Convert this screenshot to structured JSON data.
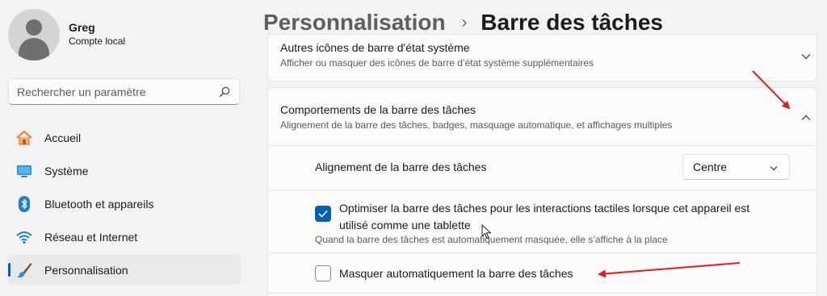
{
  "user": {
    "name": "Greg",
    "account_type": "Compte local"
  },
  "search": {
    "placeholder": "Rechercher un paramètre"
  },
  "sidebar": {
    "items": [
      {
        "label": "Accueil",
        "icon": "home-icon"
      },
      {
        "label": "Système",
        "icon": "system-display-icon"
      },
      {
        "label": "Bluetooth et appareils",
        "icon": "bluetooth-icon"
      },
      {
        "label": "Réseau et Internet",
        "icon": "wifi-icon"
      },
      {
        "label": "Personnalisation",
        "icon": "brush-icon",
        "active": true
      }
    ]
  },
  "breadcrumb": {
    "parent": "Personnalisation",
    "separator": "›",
    "current": "Barre des tâches"
  },
  "sections": {
    "system_tray_icons": {
      "title": "Autres icônes de barre d'état système",
      "subtitle": "Afficher ou masquer des icônes de barre d’état système supplémentaires",
      "expanded": false
    },
    "behaviors": {
      "title": "Comportements de la barre des tâches",
      "subtitle": "Alignement de la barre des tâches, badges, masquage automatique, et affichages multiples",
      "expanded": true,
      "alignment": {
        "label": "Alignement de la barre des tâches",
        "value": "Centre"
      },
      "touch_optimize": {
        "label": "Optimiser la barre des tâches pour les interactions tactiles lorsque cet appareil est utilisé comme une tablette",
        "help": "Quand la barre des tâches est automatiquement masquée, elle s’affiche à la place",
        "checked": true
      },
      "auto_hide": {
        "label": "Masquer automatiquement la barre des tâches",
        "checked": false
      }
    }
  },
  "colors": {
    "accent": "#005fb8",
    "annotation_arrow": "#e8191b"
  }
}
